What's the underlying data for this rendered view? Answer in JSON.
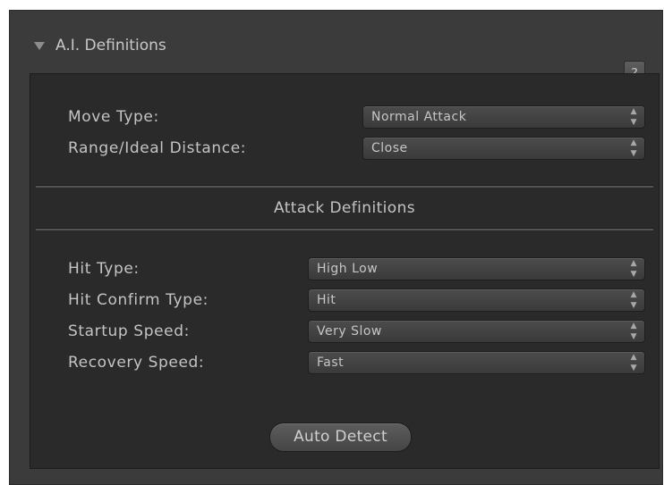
{
  "section": {
    "title": "A.I. Definitions",
    "help_label": "?"
  },
  "move": {
    "rows": [
      {
        "label": "Move Type:",
        "value": "Normal Attack"
      },
      {
        "label": "Range/Ideal Distance:",
        "value": "Close"
      }
    ]
  },
  "attack": {
    "header": "Attack Definitions",
    "rows": [
      {
        "label": "Hit Type:",
        "value": "High Low"
      },
      {
        "label": "Hit Confirm Type:",
        "value": "Hit"
      },
      {
        "label": "Startup Speed:",
        "value": "Very Slow"
      },
      {
        "label": "Recovery Speed:",
        "value": "Fast"
      }
    ]
  },
  "auto_detect_label": "Auto Detect",
  "icons": {
    "foldout": "triangle-down-icon",
    "dropdown": "up-down-arrows-icon"
  },
  "colors": {
    "window_bg": "#3b3b3b",
    "panel_bg": "#2a2a2a",
    "text": "#c4c4c4"
  }
}
